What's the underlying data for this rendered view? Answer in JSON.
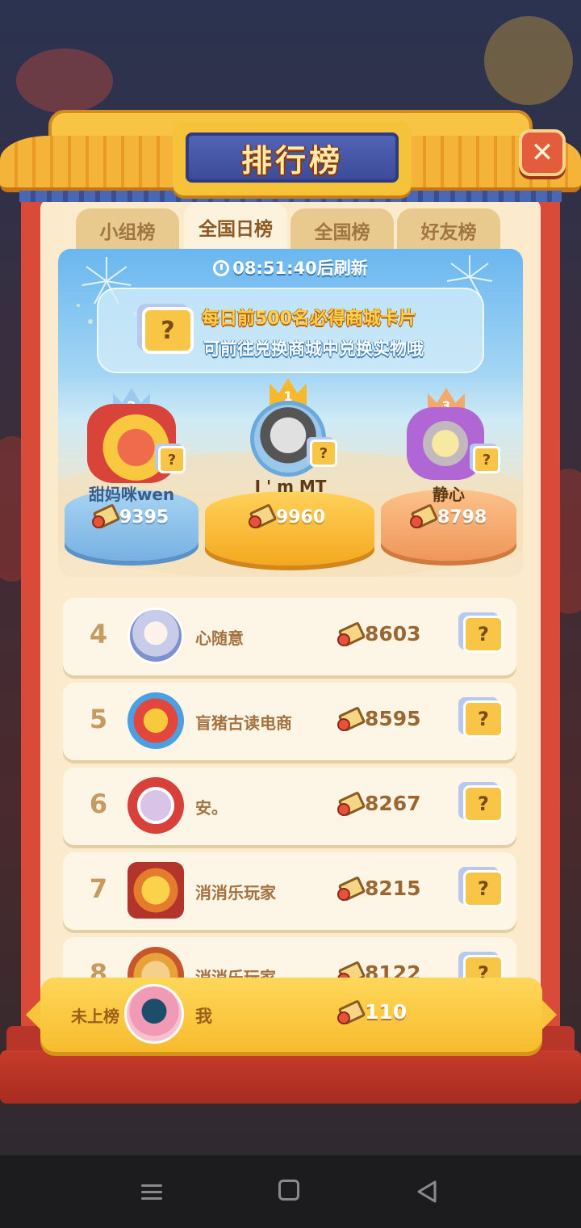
{
  "header": {
    "title": "排行榜",
    "close_label": "✕"
  },
  "tabs": [
    {
      "label": "小组榜",
      "active": false
    },
    {
      "label": "全国日榜",
      "active": true
    },
    {
      "label": "全国榜",
      "active": false
    },
    {
      "label": "好友榜",
      "active": false
    }
  ],
  "refresh_text": "08:51:40后刷新",
  "banner": {
    "line1": "每日前500名必得商城卡片",
    "line2": "可前往兑换商城中兑换实物哦",
    "card_icon": "?"
  },
  "podium": [
    {
      "rank": "2",
      "name": "甜妈咪wen",
      "score": "9395"
    },
    {
      "rank": "1",
      "name": "I ' m MT",
      "score": "9960"
    },
    {
      "rank": "3",
      "name": "静心",
      "score": "8798"
    }
  ],
  "list": [
    {
      "rank": "4",
      "name": "心随意",
      "score": "8603"
    },
    {
      "rank": "5",
      "name": "盲猪古读电商",
      "score": "8595"
    },
    {
      "rank": "6",
      "name": "安。",
      "score": "8267"
    },
    {
      "rank": "7",
      "name": "消消乐玩家",
      "score": "8215"
    },
    {
      "rank": "8",
      "name": "消消乐玩家",
      "score": "8122"
    }
  ],
  "me": {
    "status": "未上榜",
    "name": "我",
    "score": "110"
  },
  "colors": {
    "frame": "#d94a38",
    "roof": "#f4b43a",
    "plaque": "#4a5aa8",
    "highlight": "#f7bc2d"
  },
  "icons": [
    "clock-icon",
    "brush-icon",
    "mystery-card-icon",
    "close-icon",
    "crown-icon"
  ]
}
